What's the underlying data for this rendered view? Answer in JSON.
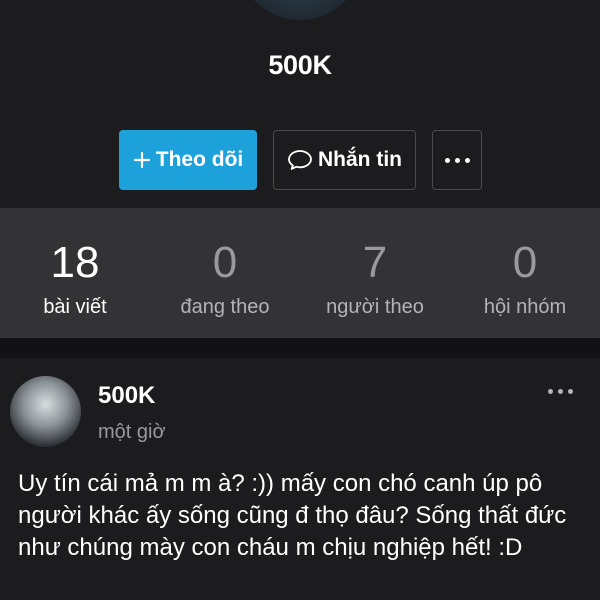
{
  "profile": {
    "name": "500K"
  },
  "actions": {
    "follow_label": "Theo dõi",
    "message_label": "Nhắn tin",
    "follow_color": "#1da1db"
  },
  "stats": [
    {
      "value": "18",
      "label": "bài viết"
    },
    {
      "value": "0",
      "label": "đang theo"
    },
    {
      "value": "7",
      "label": "người theo"
    },
    {
      "value": "0",
      "label": "hội nhóm"
    }
  ],
  "post": {
    "author": "500K",
    "time": "một giờ",
    "body": "Uy tín cái mả m m à? :)) mấy con chó canh úp pô người khác ấy sống cũng đ thọ đâu? Sống thất đức như chúng mày con cháu m chịu nghiệp hết! :D"
  },
  "icons": {
    "follow": "plus-icon",
    "message": "chat-bubble-icon",
    "more": "more-dots-icon"
  }
}
